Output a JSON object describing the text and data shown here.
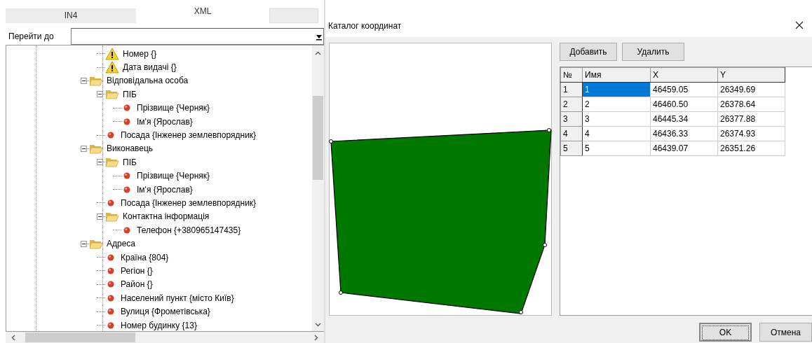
{
  "left_panel": {
    "tabs": [
      {
        "label": "IN4",
        "selected": false
      },
      {
        "label": "XML",
        "selected": true
      },
      {
        "selected": false
      }
    ],
    "go_to": {
      "label": "Перейти до"
    },
    "tree": [
      {
        "children": [
          {
            "kind": "warning",
            "label": "Номер {}"
          },
          {
            "kind": "warning",
            "label": "Дата видачі {}"
          }
        ]
      },
      {
        "kind": "folder",
        "label": "Відповідальна особа",
        "expanded": true,
        "children": [
          {
            "kind": "folder",
            "label": "ПІБ",
            "expanded": true,
            "children": [
              {
                "kind": "leaf",
                "label": "Прізвище {Черняк}"
              },
              {
                "kind": "leaf",
                "label": "Ім'я {Ярослав}"
              }
            ]
          },
          {
            "kind": "leaf",
            "label": "Посада {Інженер землевпорядник}"
          }
        ]
      },
      {
        "kind": "folder",
        "label": "Виконавець",
        "expanded": true,
        "children": [
          {
            "kind": "folder",
            "label": "ПІБ",
            "expanded": true,
            "children": [
              {
                "kind": "leaf",
                "label": "Прізвище {Черняк}"
              },
              {
                "kind": "leaf",
                "label": "Ім'я {Ярослав}"
              }
            ]
          },
          {
            "kind": "leaf",
            "label": "Посада {Інженер землевпорядник}"
          },
          {
            "kind": "folder",
            "label": "Контактна інформація",
            "expanded": true,
            "children": [
              {
                "kind": "leaf",
                "label": "Телефон {+380965147435}"
              }
            ]
          }
        ]
      },
      {
        "kind": "folder",
        "label": "Адреса",
        "expanded": true,
        "children": [
          {
            "kind": "leaf",
            "label": "Країна {804}"
          },
          {
            "kind": "leaf",
            "label": "Регіон {}"
          },
          {
            "kind": "leaf",
            "label": "Район {}"
          },
          {
            "kind": "leaf",
            "label": "Населений пункт {місто Київ}"
          },
          {
            "kind": "leaf",
            "label": "Вулиця {Фрометівська}"
          },
          {
            "kind": "leaf",
            "label": "Номер будинку {13}"
          }
        ]
      }
    ]
  },
  "dialog": {
    "title": "Каталог координат",
    "toolbar": [
      "Добавить",
      "Удалить"
    ],
    "table": {
      "columns": [
        "№",
        "Имя",
        "X",
        "Y"
      ],
      "rows": [
        {
          "cells": [
            "1",
            "1",
            "46459.05",
            "26349.69"
          ],
          "selected": true
        },
        {
          "cells": [
            "2",
            "2",
            "46460.50",
            "26378.64"
          ],
          "selected": false
        },
        {
          "cells": [
            "3",
            "3",
            "46445.34",
            "26377.88"
          ],
          "selected": false
        },
        {
          "cells": [
            "4",
            "4",
            "46436.33",
            "26374.93"
          ],
          "selected": false
        },
        {
          "cells": [
            "5",
            "5",
            "46439.07",
            "26351.26"
          ],
          "selected": false
        }
      ]
    },
    "buttons": [
      {
        "label": "OK",
        "default": true
      },
      {
        "label": "Отмена",
        "default": false
      }
    ]
  }
}
